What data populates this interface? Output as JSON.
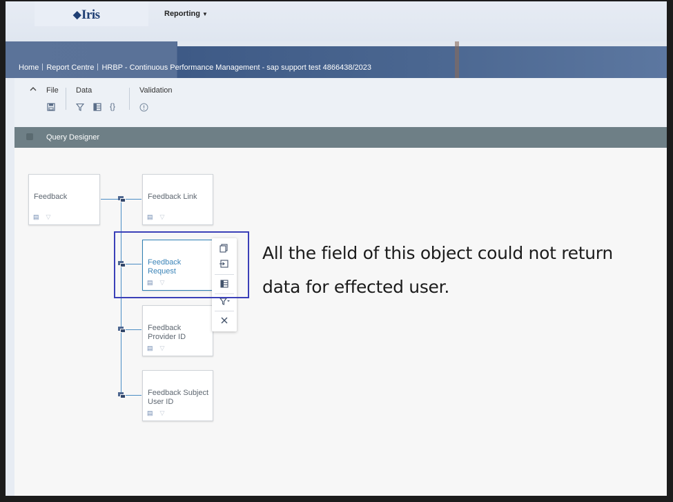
{
  "app": {
    "logo": "Iris",
    "menu_reporting": "Reporting"
  },
  "breadcrumb": {
    "home": "Home",
    "report_centre": "Report Centre",
    "current": "HRBP - Continuous Performance Management - sap support test 4866438/2023"
  },
  "toolbar": {
    "file_label": "File",
    "data_label": "Data",
    "validation_label": "Validation",
    "collapse_icon": "chevron-up-icon",
    "file_icons": [
      "save-icon"
    ],
    "data_icons": [
      "filter-icon",
      "table-icon",
      "braces-icon"
    ],
    "validation_icons": [
      "alert-circle-icon"
    ]
  },
  "query_designer": {
    "title": "Query Designer"
  },
  "nodes": {
    "feedback": "Feedback",
    "feedback_link": "Feedback Link",
    "feedback_request": "Feedback\nRequest",
    "feedback_provider": "Feedback\nProvider ID",
    "feedback_subject": "Feedback Subject\nUser ID"
  },
  "actions": [
    "copy-icon",
    "insert-icon",
    "table-icon",
    "filter-dropdown-icon",
    "close-icon"
  ],
  "annotation": {
    "line1": "All the field of this object could not return",
    "line2": "data for effected user."
  },
  "colors": {
    "accent": "#2f7fb3",
    "highlight_box": "#3a3fb8",
    "qd_header": "#6e7f86"
  }
}
